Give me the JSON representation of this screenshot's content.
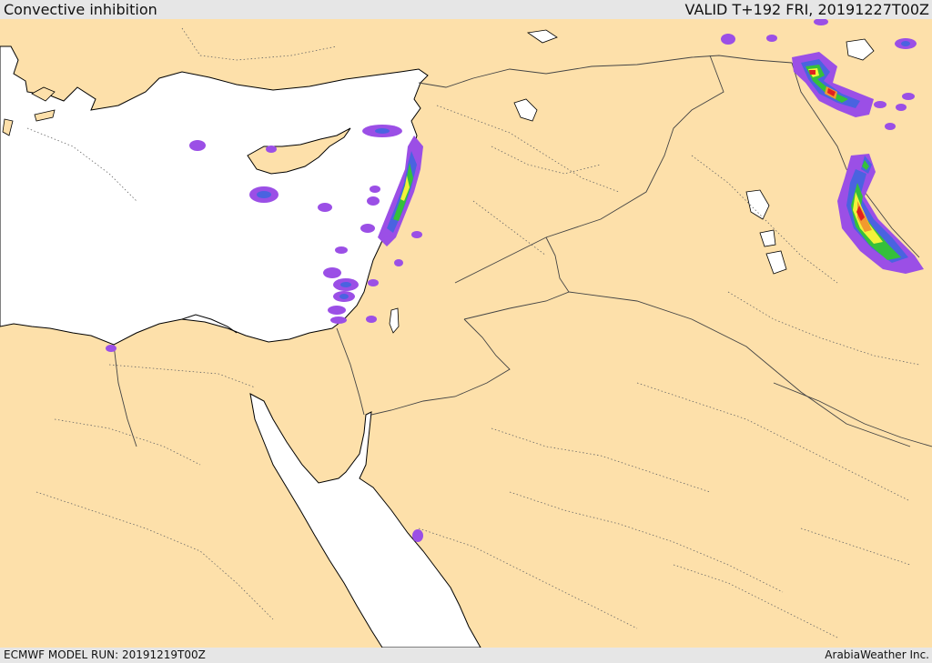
{
  "header": {
    "title": "Convective inhibition",
    "valid": "VALID T+192 FRI, 20191227T00Z"
  },
  "footer": {
    "model_run": "ECMWF MODEL RUN: 20191219T00Z",
    "credit": "ArabiaWeather Inc."
  },
  "colors": {
    "land": "#fde0aa",
    "sea": "#ffffff",
    "coast": "#000000",
    "border": "#555555",
    "cin_purple": "#9b4fe6",
    "cin_blue": "#4a63e0",
    "cin_green": "#35c03a",
    "cin_yellow": "#f2f23a",
    "cin_orange": "#f29a2e",
    "cin_red": "#e02020"
  },
  "map": {
    "region": "Eastern Mediterranean & Middle East",
    "field": "CIN"
  }
}
